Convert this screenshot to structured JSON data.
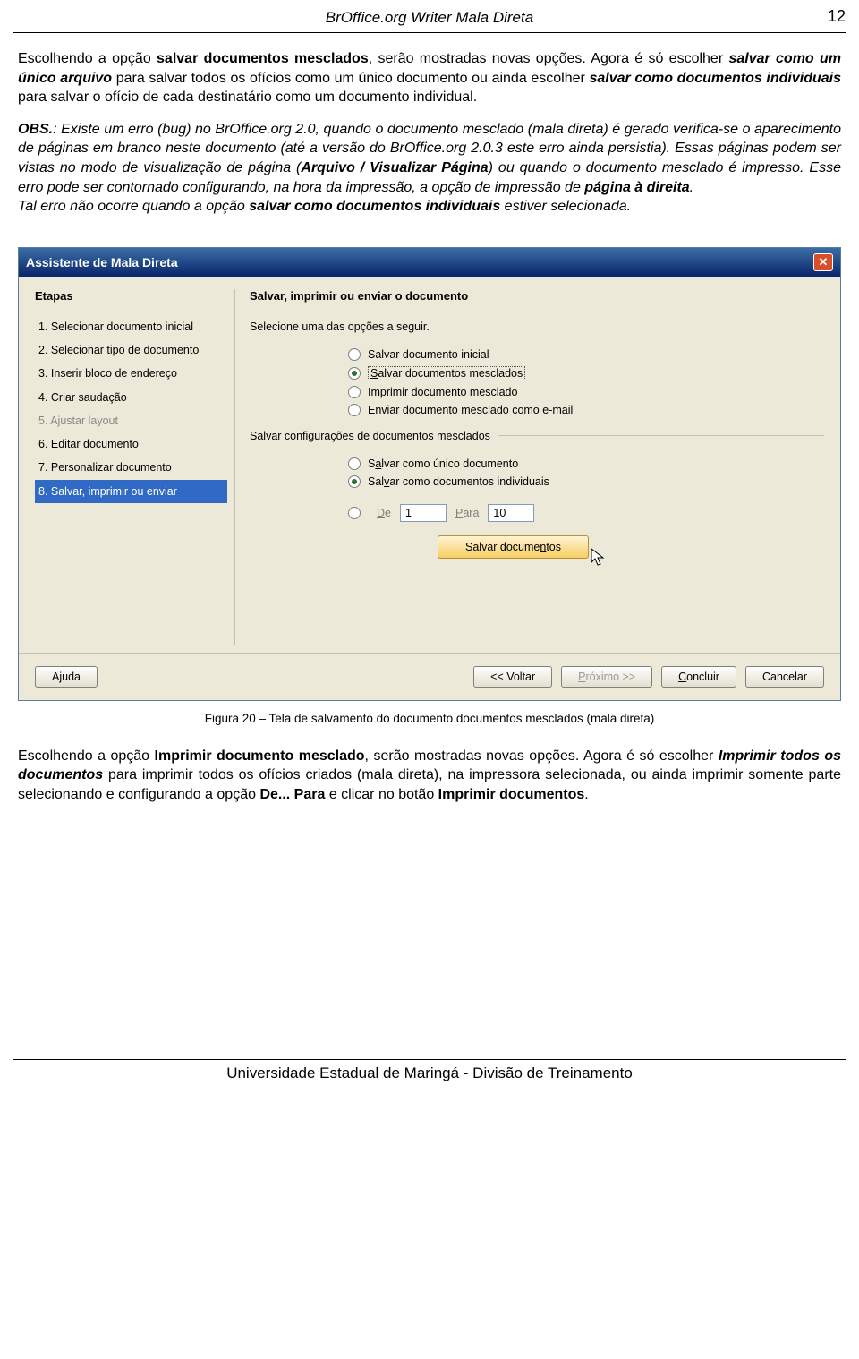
{
  "header": {
    "title": "BrOffice.org Writer Mala Direta",
    "page_no": "12"
  },
  "para": {
    "p1a": "Escolhendo a opção ",
    "p1b": "salvar documentos mesclados",
    "p1c": ", serão mostradas novas opções. Agora é só escolher ",
    "p1d": "salvar como um único arquivo",
    "p1e": " para salvar todos os ofícios como um único documento ou ainda escolher ",
    "p1f": "salvar como documentos individuais",
    "p1g": " para salvar o ofício de cada destinatário como um documento individual.",
    "obs_label": "OBS.",
    "obs_a": ": Existe um erro (bug) no BrOffice.org 2.0, quando o documento mesclado (mala direta) é gerado verifica-se o aparecimento de páginas em branco neste documento (até a versão do BrOffice.org 2.0.3 este erro ainda persistia). Essas páginas podem ser vistas no modo de visualização de página (",
    "obs_b": "Arquivo / Visualizar Página",
    "obs_c": ") ou quando o documento mesclado é impresso. Esse erro pode ser contornado configurando, na hora da impressão, a opção de impressão de ",
    "obs_d": "página à direita",
    "obs_e": ".",
    "obs_f": "Tal erro não ocorre quando a opção ",
    "obs_g": "salvar como documentos individuais",
    "obs_h": " estiver selecionada.",
    "caption": "Figura 20 – Tela de salvamento do documento documentos mesclados (mala direta)",
    "p2a": "Escolhendo a opção ",
    "p2b": "Imprimir documento mesclado",
    "p2c": ", serão mostradas novas opções. Agora é só escolher ",
    "p2d": "Imprimir todos os documentos",
    "p2e": " para imprimir todos os ofícios criados (mala direta), na impressora selecionada, ou ainda imprimir somente parte selecionando e configurando a opção ",
    "p2f": "De... Para",
    "p2g": " e clicar no botão ",
    "p2h": "Imprimir documentos",
    "p2i": "."
  },
  "dlg": {
    "title": "Assistente de Mala Direta",
    "steps_header": "Etapas",
    "steps": [
      "1.  Selecionar documento inicial",
      "2.  Selecionar tipo de documento",
      "3.  Inserir bloco de endereço",
      "4.  Criar saudação",
      "5.  Ajustar layout",
      "6.  Editar documento",
      "7.  Personalizar documento",
      "8.  Salvar, imprimir ou enviar"
    ],
    "main_header": "Salvar, imprimir ou enviar o documento",
    "prompt": "Selecione uma das opções a seguir.",
    "opt1": "Salvar documento inicial",
    "opt2": "Salvar documentos mesclados",
    "opt3": "Imprimir documento mesclado",
    "opt4": "Enviar documento mesclado como e-mail",
    "legend": "Salvar configurações de documentos mesclados",
    "optA": "Salvar como único documento",
    "optB": "Salvar como documentos individuais",
    "de": "De",
    "de_val": "1",
    "para": "Para",
    "para_val": "10",
    "save_btn": "Salvar documentos",
    "help": "Ajuda",
    "back": "<< Voltar",
    "next": "Próximo >>",
    "finish": "Concluir",
    "cancel": "Cancelar"
  },
  "footer": {
    "text": "Universidade Estadual de Maringá - Divisão de Treinamento"
  }
}
